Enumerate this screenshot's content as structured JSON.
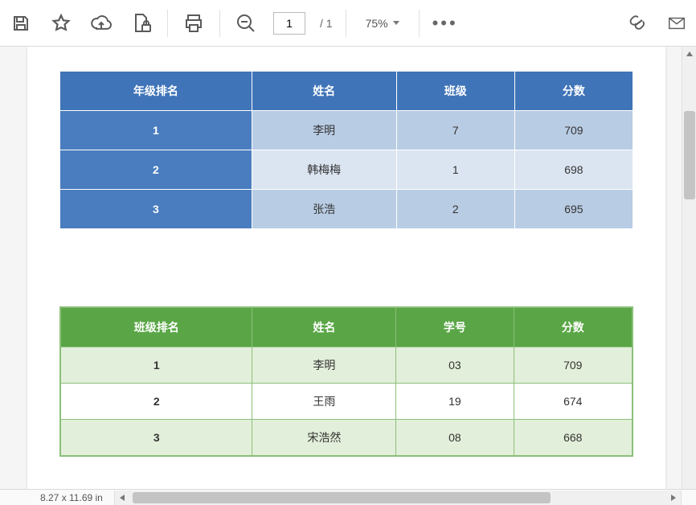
{
  "toolbar": {
    "page_current": "1",
    "page_total": "/  1",
    "zoom_value": "75%"
  },
  "status": {
    "page_size": "8.27 x 11.69 in"
  },
  "blue_table": {
    "headers": [
      "年级排名",
      "姓名",
      "班级",
      "分数"
    ],
    "rows": [
      {
        "rank": "1",
        "name": "李明",
        "class": "7",
        "score": "709"
      },
      {
        "rank": "2",
        "name": "韩梅梅",
        "class": "1",
        "score": "698"
      },
      {
        "rank": "3",
        "name": "张浩",
        "class": "2",
        "score": "695"
      }
    ]
  },
  "green_table": {
    "headers": [
      "班级排名",
      "姓名",
      "学号",
      "分数"
    ],
    "rows": [
      {
        "rank": "1",
        "name": "李明",
        "id": "03",
        "score": "709"
      },
      {
        "rank": "2",
        "name": "王雨",
        "id": "19",
        "score": "674"
      },
      {
        "rank": "3",
        "name": "宋浩然",
        "id": "08",
        "score": "668"
      }
    ]
  }
}
